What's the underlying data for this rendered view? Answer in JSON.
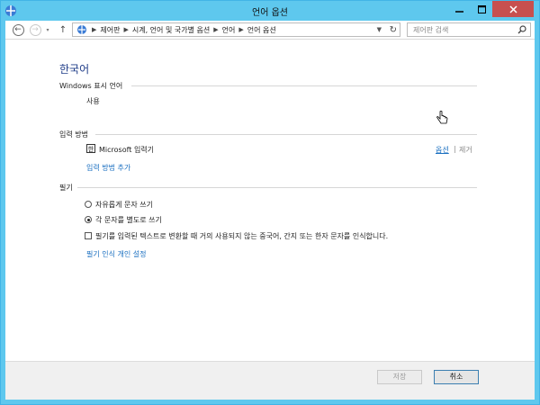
{
  "window": {
    "title": "언어 옵션"
  },
  "address_bar": {
    "breadcrumbs": [
      "제어판",
      "시계, 언어 및 국가별 옵션",
      "언어",
      "언어 옵션"
    ]
  },
  "search": {
    "placeholder": "제어판 검색"
  },
  "page": {
    "heading": "한국어",
    "display_language": {
      "label": "Windows 표시 언어",
      "value": "사용"
    },
    "input_method": {
      "label": "입력 방법",
      "ime_icon_glyph": "한",
      "ime_name": "Microsoft 입력기",
      "options_link": "옵션",
      "separator": "|",
      "remove_link": "제거",
      "add_link": "입력 방법 추가"
    },
    "handwriting": {
      "label": "필기",
      "option_freeform": "자유롭게 문자 쓰기",
      "option_per_char": "각 문자를 별도로 쓰기",
      "selected": "option_per_char",
      "checkbox_label": "필기를 입력된 텍스트로 변환할 때 거의 사용되지 않는 중국어, 간지 또는 한자 문자를 인식합니다.",
      "checkbox_checked": false,
      "personalize_link": "필기 인식 개인 설정"
    }
  },
  "footer": {
    "save_label": "저장",
    "cancel_label": "취소"
  },
  "colors": {
    "accent": "#5ec8ee",
    "link": "#1a6fc0",
    "heading": "#1f3c88",
    "close_button": "#c7504f"
  }
}
